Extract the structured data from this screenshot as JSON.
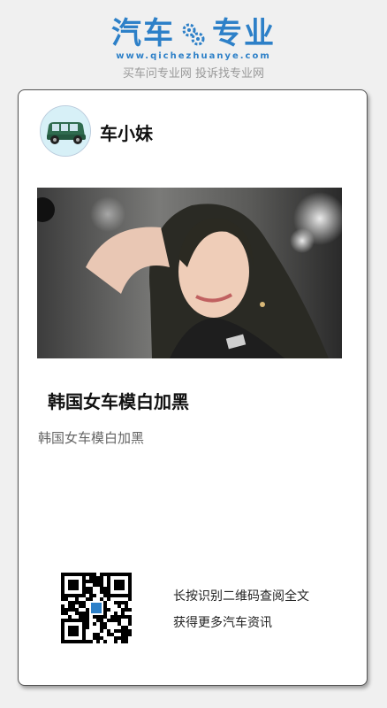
{
  "brand": {
    "logo_left": "汽车",
    "logo_right": "专业",
    "url": "www.qichezhuanye.com",
    "slogan": "买车问专业网 投诉找专业网",
    "color": "#2d80c8"
  },
  "card": {
    "author_name": "车小妹",
    "article_title": "韩国女车模白加黑",
    "article_summary": "韩国女车模白加黑",
    "qr_line1": "长按识别二维码查阅全文",
    "qr_line2": "获得更多汽车资讯"
  },
  "icons": {
    "avatar": "car-icon",
    "logo": "gear-icon",
    "qr": "qr-code-icon"
  }
}
